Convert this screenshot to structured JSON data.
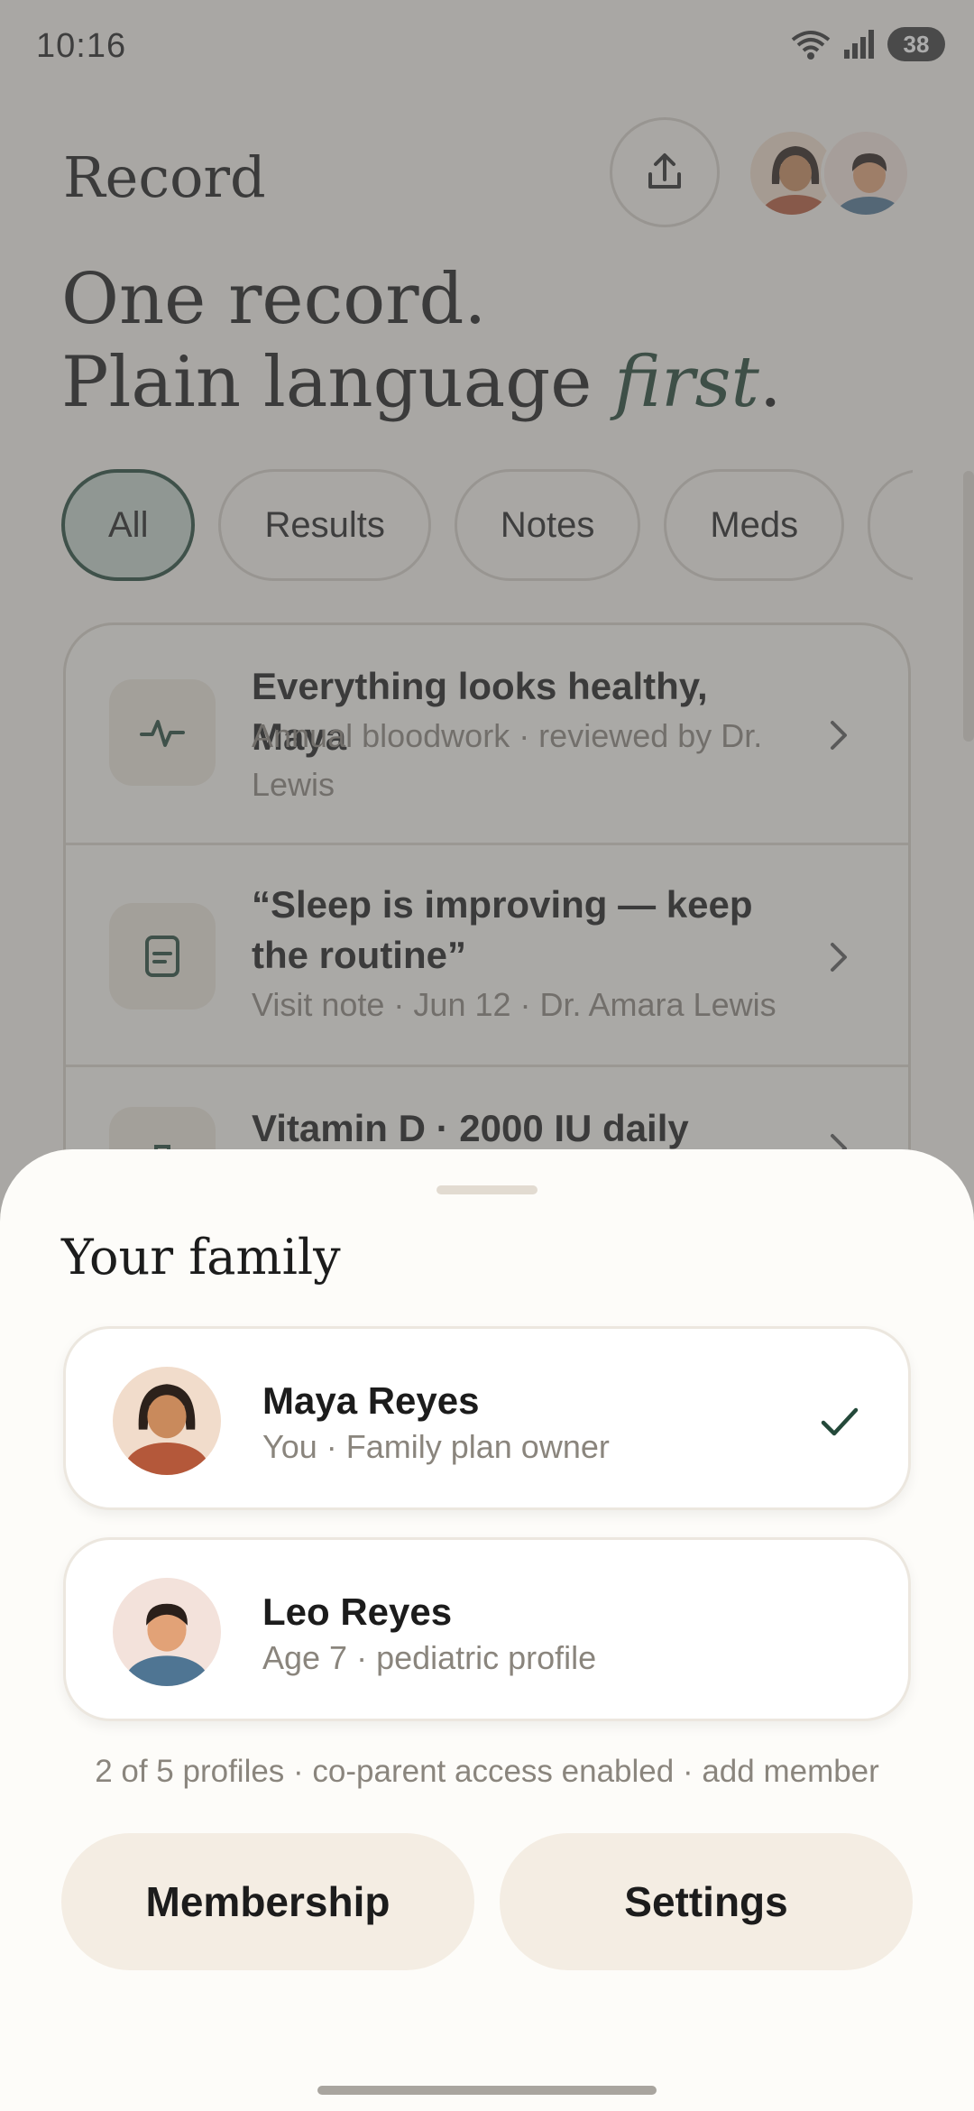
{
  "status_bar": {
    "time": "10:16",
    "battery": "38",
    "icons": [
      "wifi-icon",
      "signal-icon",
      "battery-icon"
    ]
  },
  "header": {
    "title": "Record",
    "share_icon": "share-upload-icon"
  },
  "hero": {
    "line1": "One record.",
    "line2_prefix": "Plain language ",
    "line2_emphasis": "first",
    "line2_suffix": "."
  },
  "filters": {
    "items": [
      {
        "label": "All",
        "active": true
      },
      {
        "label": "Results",
        "active": false
      },
      {
        "label": "Notes",
        "active": false
      },
      {
        "label": "Meds",
        "active": false
      }
    ]
  },
  "records": [
    {
      "icon": "pulse-icon",
      "title": "Everything looks healthy, Maya",
      "subtitle": "Annual bloodwork · reviewed by Dr. Lewis"
    },
    {
      "icon": "note-icon",
      "title": "“Sleep is improving — keep the routine”",
      "subtitle": "Visit note · Jun 12 · Dr. Amara Lewis"
    },
    {
      "icon": "medication-bag-icon",
      "title": "Vitamin D · 2000 IU daily",
      "subtitle": ""
    }
  ],
  "sheet": {
    "title": "Your family",
    "members": [
      {
        "name": "Maya Reyes",
        "subtitle": "You · Family plan owner",
        "selected": true
      },
      {
        "name": "Leo Reyes",
        "subtitle": "Age 7 · pediatric profile",
        "selected": false
      }
    ],
    "profiles_note": "2 of 5 profiles · co-parent access enabled · add member",
    "buttons": {
      "membership": "Membership",
      "settings": "Settings"
    }
  },
  "colors": {
    "accent_green": "#24493a",
    "chip_active_bg": "#c6d5cc",
    "sheet_bg": "#fdfcf9",
    "button_bg": "#f4ede3",
    "muted_text": "#8a857d"
  }
}
